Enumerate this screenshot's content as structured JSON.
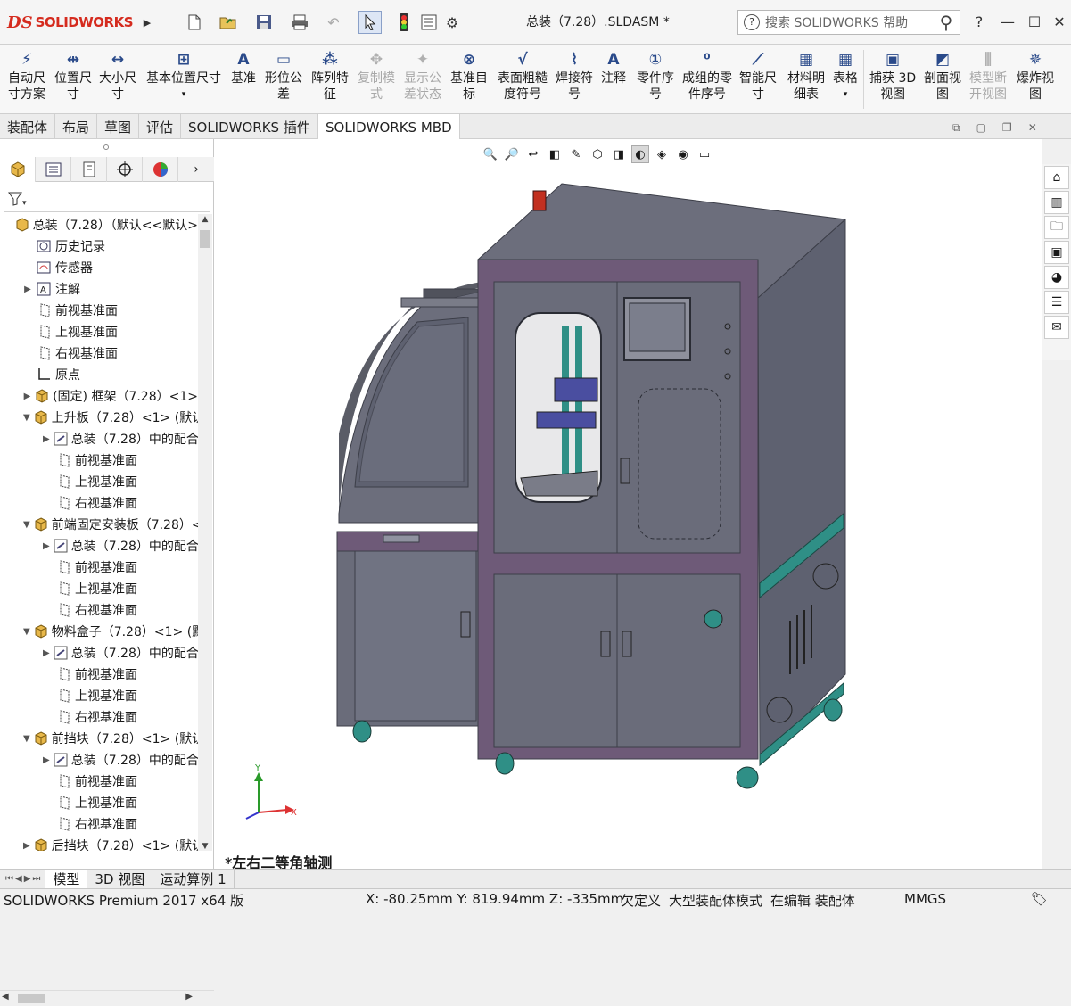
{
  "app": {
    "logo_mark": "DS",
    "logo_text": "SOLIDWORKS",
    "doc_title": "总装（7.28）.SLDASM *"
  },
  "search": {
    "placeholder": "搜索 SOLIDWORKS 帮助"
  },
  "window_buttons": {
    "help": "?",
    "minimize": "—",
    "maximize": "☐",
    "close": "✕"
  },
  "ribbon": [
    {
      "l1": "自动尺",
      "l2": "寸方案",
      "icon": "auto-dimension-icon",
      "enabled": true
    },
    {
      "l1": "位置尺",
      "l2": "寸",
      "icon": "location-dimension-icon",
      "enabled": true
    },
    {
      "l1": "大小尺",
      "l2": "寸",
      "icon": "size-dimension-icon",
      "enabled": true
    },
    {
      "l1": "基本位置尺寸",
      "l2": "",
      "icon": "basic-location-dimension-icon",
      "enabled": true
    },
    {
      "l1": "基准",
      "l2": "",
      "icon": "datum-icon",
      "enabled": true
    },
    {
      "l1": "形位公",
      "l2": "差",
      "icon": "geometric-tolerance-icon",
      "enabled": true
    },
    {
      "l1": "阵列特",
      "l2": "征",
      "icon": "pattern-feature-icon",
      "enabled": true
    },
    {
      "l1": "复制模",
      "l2": "式",
      "icon": "copy-scheme-icon",
      "enabled": false
    },
    {
      "l1": "显示公",
      "l2": "差状态",
      "icon": "show-tolerance-status-icon",
      "enabled": false
    },
    {
      "l1": "基准目",
      "l2": "标",
      "icon": "datum-target-icon",
      "enabled": true
    },
    {
      "l1": "表面粗糙",
      "l2": "度符号",
      "icon": "surface-finish-icon",
      "enabled": true
    },
    {
      "l1": "焊接符",
      "l2": "号",
      "icon": "weld-symbol-icon",
      "enabled": true
    },
    {
      "l1": "注释",
      "l2": "",
      "icon": "note-icon",
      "enabled": true
    },
    {
      "l1": "零件序",
      "l2": "号",
      "icon": "balloon-icon",
      "enabled": true
    },
    {
      "l1": "成组的零",
      "l2": "件序号",
      "icon": "stacked-balloon-icon",
      "enabled": true
    },
    {
      "l1": "智能尺",
      "l2": "寸",
      "icon": "smart-dimension-icon",
      "enabled": true
    },
    {
      "l1": "材料明",
      "l2": "细表",
      "icon": "bom-icon",
      "enabled": true
    },
    {
      "l1": "表格",
      "l2": "",
      "icon": "table-icon",
      "enabled": true
    },
    {
      "l1": "捕获 3D",
      "l2": "视图",
      "icon": "capture-3d-view-icon",
      "enabled": true
    },
    {
      "l1": "剖面视",
      "l2": "图",
      "icon": "section-view-icon",
      "enabled": true
    },
    {
      "l1": "模型断",
      "l2": "开视图",
      "icon": "model-break-view-icon",
      "enabled": false
    },
    {
      "l1": "爆炸视",
      "l2": "图",
      "icon": "exploded-view-icon",
      "enabled": true
    }
  ],
  "tabs": [
    "装配体",
    "布局",
    "草图",
    "评估",
    "SOLIDWORKS 插件",
    "SOLIDWORKS MBD"
  ],
  "active_tab": "SOLIDWORKS MBD",
  "tree": [
    {
      "text": "总装（7.28）（默认<<默认>",
      "level": 0,
      "exp": "",
      "icon": "assembly-icon"
    },
    {
      "text": "历史记录",
      "level": 1,
      "exp": "",
      "icon": "history-icon"
    },
    {
      "text": "传感器",
      "level": 1,
      "exp": "",
      "icon": "sensor-icon"
    },
    {
      "text": "注解",
      "level": 1,
      "exp": "▶",
      "icon": "annotation-icon"
    },
    {
      "text": "前视基准面",
      "level": 1,
      "exp": "",
      "icon": "plane-icon"
    },
    {
      "text": "上视基准面",
      "level": 1,
      "exp": "",
      "icon": "plane-icon"
    },
    {
      "text": "右视基准面",
      "level": 1,
      "exp": "",
      "icon": "plane-icon"
    },
    {
      "text": "原点",
      "level": 1,
      "exp": "",
      "icon": "origin-icon"
    },
    {
      "text": "(固定) 框架（7.28）<1>",
      "level": 1,
      "exp": "▶",
      "icon": "subassembly-icon"
    },
    {
      "text": "上升板（7.28）<1> (默认",
      "level": 1,
      "exp": "▼",
      "icon": "subassembly-icon"
    },
    {
      "text": "总装（7.28）中的配合",
      "level": 2,
      "exp": "▶",
      "icon": "mates-icon"
    },
    {
      "text": "前视基准面",
      "level": 2,
      "exp": "",
      "icon": "plane-icon"
    },
    {
      "text": "上视基准面",
      "level": 2,
      "exp": "",
      "icon": "plane-icon"
    },
    {
      "text": "右视基准面",
      "level": 2,
      "exp": "",
      "icon": "plane-icon"
    },
    {
      "text": "前端固定安装板（7.28）<",
      "level": 1,
      "exp": "▼",
      "icon": "subassembly-icon"
    },
    {
      "text": "总装（7.28）中的配合",
      "level": 2,
      "exp": "▶",
      "icon": "mates-icon"
    },
    {
      "text": "前视基准面",
      "level": 2,
      "exp": "",
      "icon": "plane-icon"
    },
    {
      "text": "上视基准面",
      "level": 2,
      "exp": "",
      "icon": "plane-icon"
    },
    {
      "text": "右视基准面",
      "level": 2,
      "exp": "",
      "icon": "plane-icon"
    },
    {
      "text": "物料盒子（7.28）<1> (默",
      "level": 1,
      "exp": "▼",
      "icon": "subassembly-icon"
    },
    {
      "text": "总装（7.28）中的配合",
      "level": 2,
      "exp": "▶",
      "icon": "mates-icon"
    },
    {
      "text": "前视基准面",
      "level": 2,
      "exp": "",
      "icon": "plane-icon"
    },
    {
      "text": "上视基准面",
      "level": 2,
      "exp": "",
      "icon": "plane-icon"
    },
    {
      "text": "右视基准面",
      "level": 2,
      "exp": "",
      "icon": "plane-icon"
    },
    {
      "text": "前挡块（7.28）<1> (默认",
      "level": 1,
      "exp": "▼",
      "icon": "subassembly-icon"
    },
    {
      "text": "总装（7.28）中的配合",
      "level": 2,
      "exp": "▶",
      "icon": "mates-icon"
    },
    {
      "text": "前视基准面",
      "level": 2,
      "exp": "",
      "icon": "plane-icon"
    },
    {
      "text": "上视基准面",
      "level": 2,
      "exp": "",
      "icon": "plane-icon"
    },
    {
      "text": "右视基准面",
      "level": 2,
      "exp": "",
      "icon": "plane-icon"
    },
    {
      "text": "后挡块（7.28）<1> (默认",
      "level": 1,
      "exp": "▶",
      "icon": "subassembly-icon"
    }
  ],
  "view_name": "*左右二等角轴测",
  "triad": {
    "x": "X",
    "y": "Y"
  },
  "bottom_tabs": [
    "模型",
    "3D 视图",
    "运动算例 1"
  ],
  "active_bottom_tab": "模型",
  "status": {
    "product": "SOLIDWORKS Premium 2017 x64 版",
    "coords": "X: -80.25mm Y: 819.94mm Z: -335mm",
    "define": "欠定义",
    "mode": "大型装配体模式",
    "editing": "在编辑 装配体",
    "units": "MMGS"
  },
  "colors": {
    "accent_red": "#d52b1e",
    "frame_purple": "#6e5a78",
    "panel_gray": "#6c6e7c",
    "teal": "#2f8f86"
  }
}
